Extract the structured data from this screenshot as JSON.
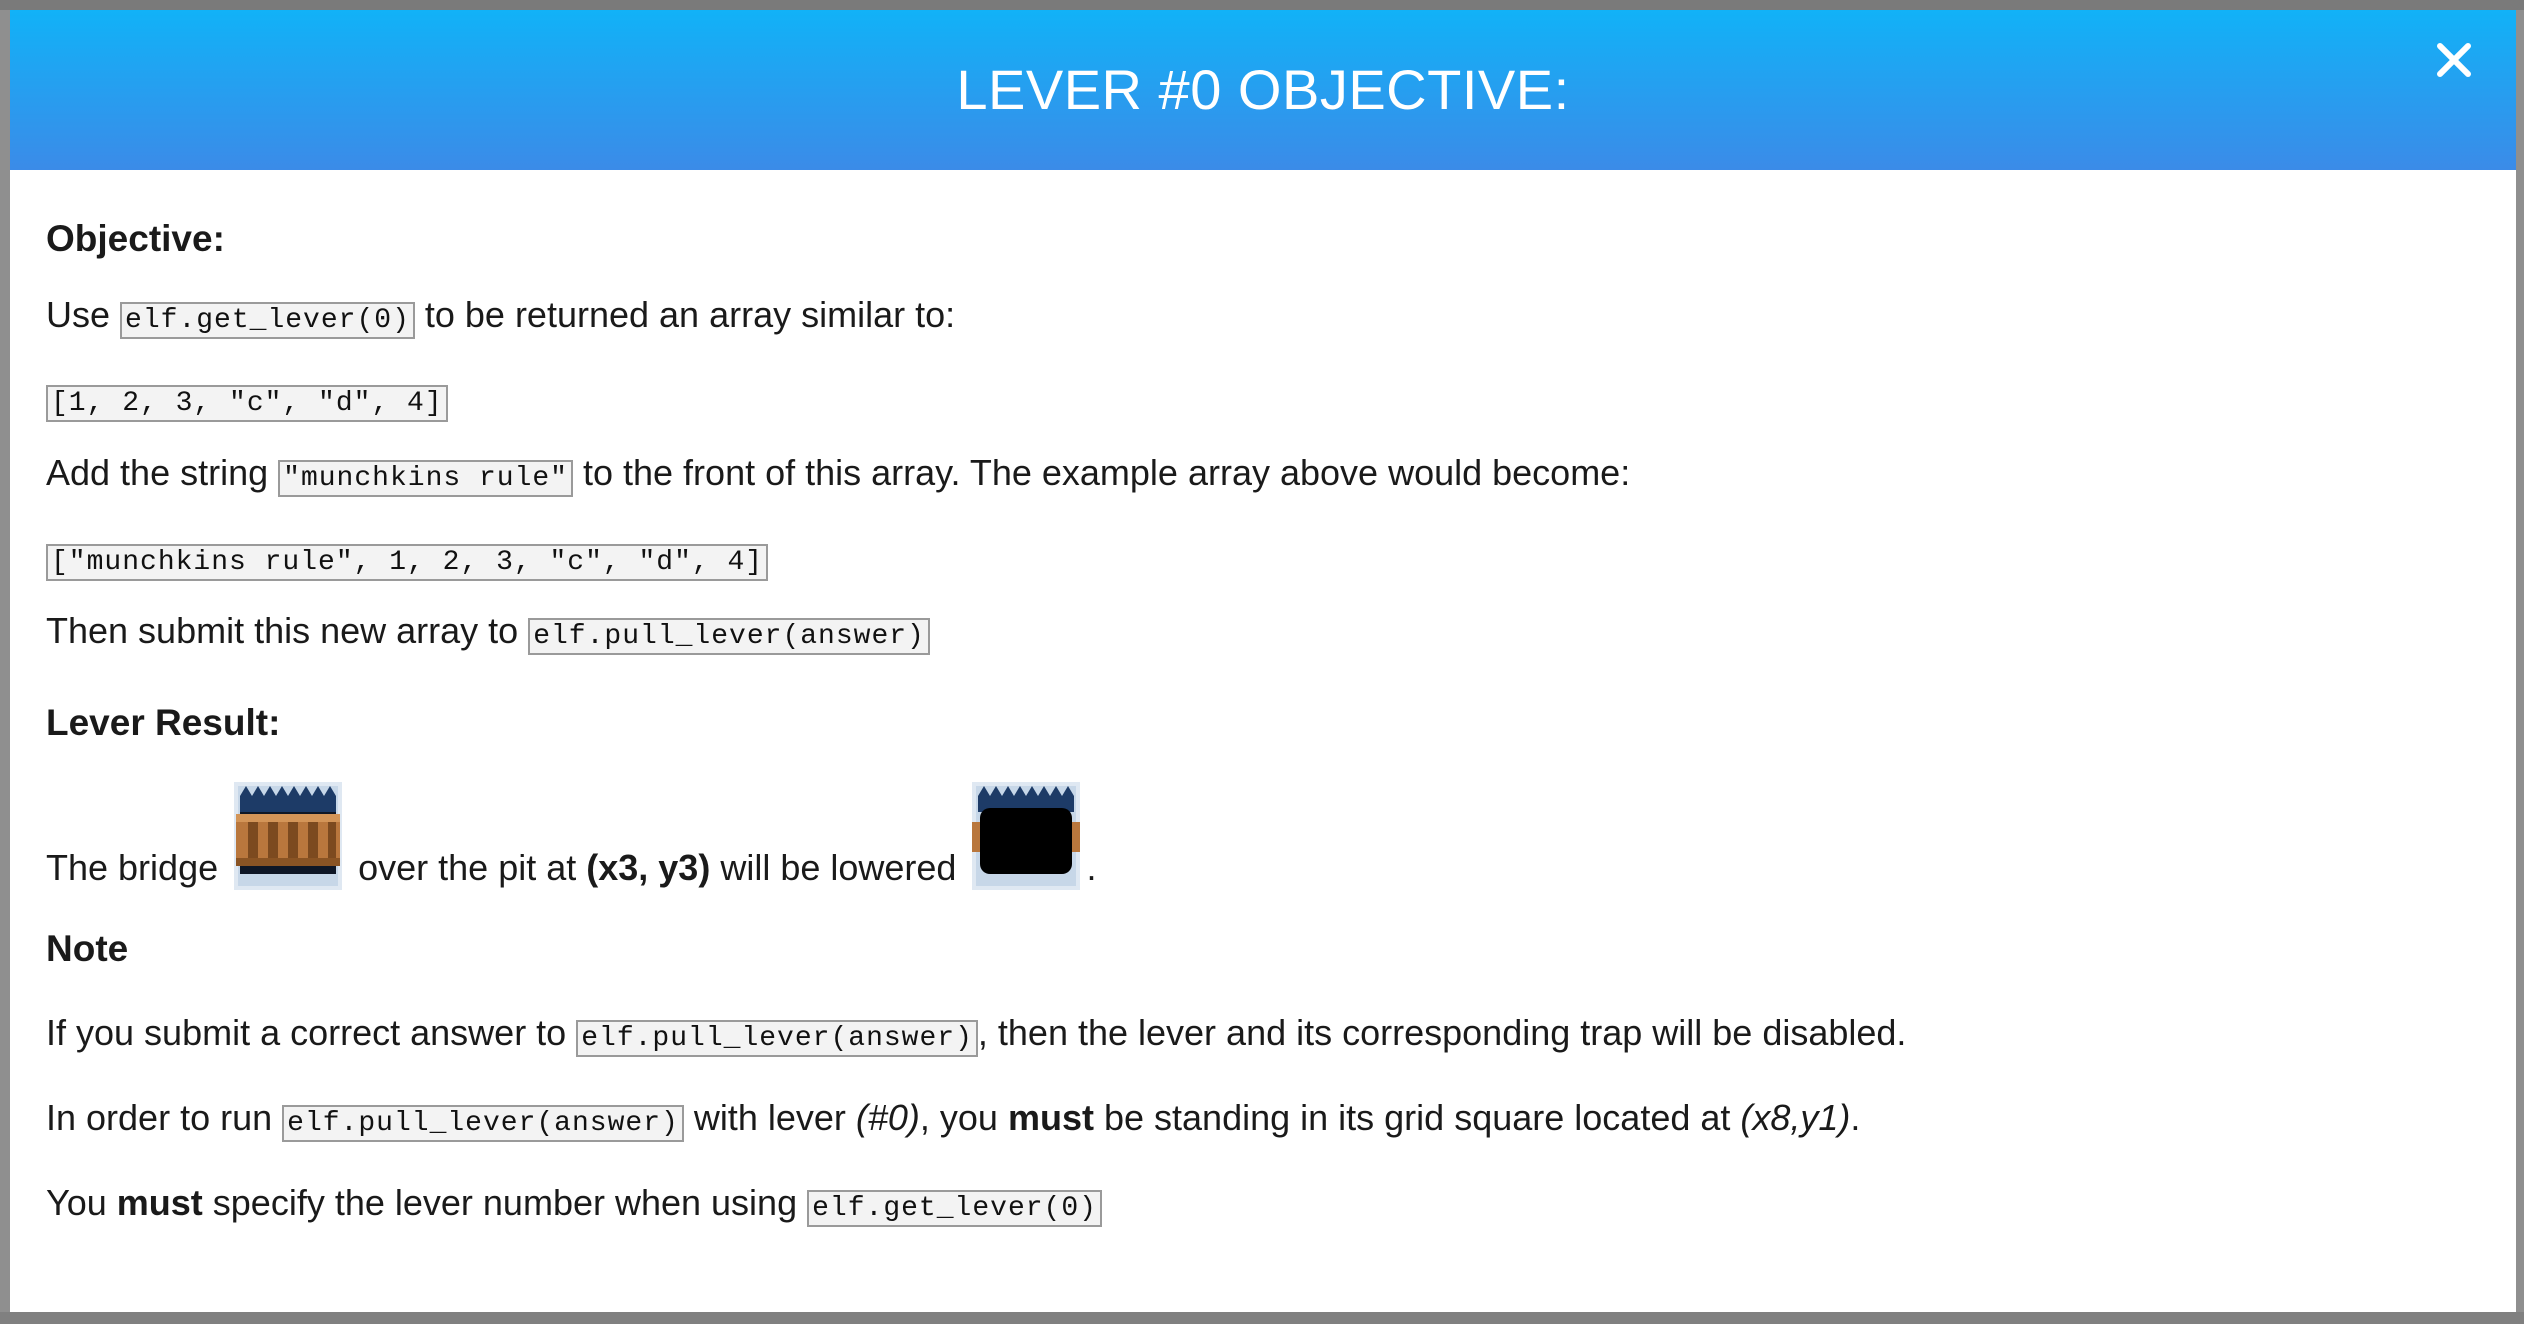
{
  "modal": {
    "title": "LEVER #0 OBJECTIVE:",
    "close_symbol": "✕"
  },
  "body": {
    "objective_heading": "Objective:",
    "line1": {
      "pre": "Use ",
      "code": "elf.get_lever(0)",
      "post": " to be returned an array similar to:"
    },
    "example_array": "[1, 2, 3, \"c\", \"d\", 4]",
    "line2": {
      "pre": "Add the string ",
      "code": "\"munchkins rule\"",
      "post": " to the front of this array. The example array above would become:"
    },
    "result_array": "[\"munchkins rule\", 1, 2, 3, \"c\", \"d\", 4]",
    "line3": {
      "pre": "Then submit this new array to ",
      "code": "elf.pull_lever(answer)"
    },
    "lever_result_heading": "Lever Result:",
    "bridge_line": {
      "pre": "The bridge ",
      "mid": " over the pit at ",
      "coords": "(x3, y3)",
      "post": " will be lowered ",
      "end": "."
    },
    "note_heading": "Note",
    "note1": {
      "pre": "If you submit a correct answer to ",
      "code": "elf.pull_lever(answer)",
      "post": ", then the lever and its corresponding trap will be disabled."
    },
    "note2": {
      "pre": "In order to run ",
      "code": "elf.pull_lever(answer)",
      "mid1": " with lever ",
      "lever": "(#0)",
      "mid2": ", you ",
      "must": "must",
      "mid3": " be standing in its grid square located at ",
      "grid": "(x8,y1)",
      "end": "."
    },
    "note3": {
      "pre": "You ",
      "must": "must",
      "mid": " specify the lever number when using ",
      "code": "elf.get_lever(0)"
    }
  },
  "icons": {
    "bridge": "bridge-tile-icon",
    "pit": "pit-tile-icon",
    "close": "close-icon"
  },
  "colors": {
    "header_top": "#11b2f7",
    "header_bottom": "#3b8be8",
    "code_border": "#9a9a9a"
  }
}
